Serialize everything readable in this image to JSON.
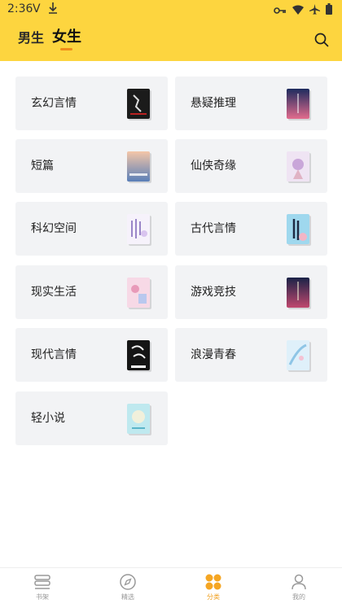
{
  "status_bar": {
    "time": "2:36",
    "carrier_letter": "V",
    "icons": [
      "download-icon",
      "key-icon",
      "wifi-icon",
      "airplane-icon",
      "battery-icon"
    ]
  },
  "header": {
    "tabs": [
      {
        "label": "男生",
        "selected": false
      },
      {
        "label": "女生",
        "selected": true
      }
    ],
    "accent_color": "#FDD53F",
    "underline_color": "#F08C1A"
  },
  "categories": [
    {
      "label": "玄幻言情",
      "cover_icon": "book-cover-icon"
    },
    {
      "label": "悬疑推理",
      "cover_icon": "book-cover-icon"
    },
    {
      "label": "短篇",
      "cover_icon": "book-cover-icon"
    },
    {
      "label": "仙侠奇缘",
      "cover_icon": "book-cover-icon"
    },
    {
      "label": "科幻空间",
      "cover_icon": "book-cover-icon"
    },
    {
      "label": "古代言情",
      "cover_icon": "book-cover-icon"
    },
    {
      "label": "现实生活",
      "cover_icon": "book-cover-icon"
    },
    {
      "label": "游戏竞技",
      "cover_icon": "book-cover-icon"
    },
    {
      "label": "现代言情",
      "cover_icon": "book-cover-icon"
    },
    {
      "label": "浪漫青春",
      "cover_icon": "book-cover-icon"
    },
    {
      "label": "轻小说",
      "cover_icon": "book-cover-icon"
    }
  ],
  "bottom_nav": [
    {
      "label": "书架",
      "icon": "bookshelf-icon",
      "active": false
    },
    {
      "label": "精选",
      "icon": "compass-icon",
      "active": false
    },
    {
      "label": "分类",
      "icon": "category-icon",
      "active": true
    },
    {
      "label": "我的",
      "icon": "profile-icon",
      "active": false
    }
  ]
}
